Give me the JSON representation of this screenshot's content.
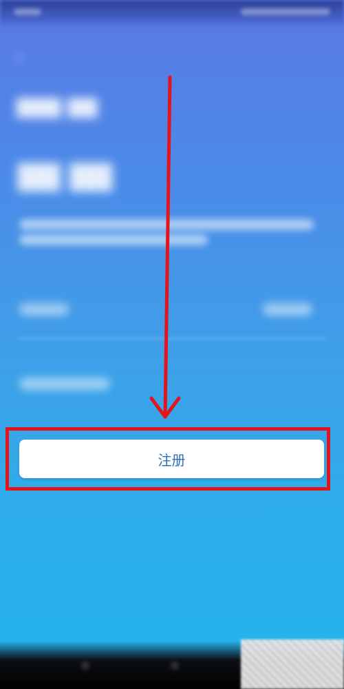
{
  "screen": {
    "background_top": "#5a79e4",
    "background_bottom": "#22b4ec",
    "highlight_color": "#e3141b"
  },
  "register": {
    "label": "注册"
  },
  "annotation": {
    "arrow_icon": "arrow-down-icon",
    "highlight_icon": "highlight-box"
  }
}
